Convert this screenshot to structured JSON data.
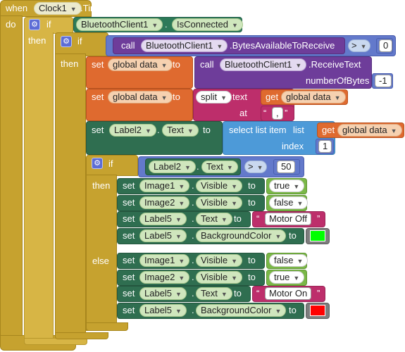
{
  "event": {
    "when": "when",
    "component": "Clock1",
    "event": ".Timer",
    "do": "do"
  },
  "outer_if": {
    "if": "if",
    "then": "then",
    "component": "BluetoothClient1",
    "property": "IsConnected"
  },
  "inner_if": {
    "if": "if",
    "then": "then",
    "call": "call",
    "component": "BluetoothClient1",
    "method": ".BytesAvailableToReceive",
    "op": ">",
    "value": "0"
  },
  "set_data_receive": {
    "set": "set",
    "var": "global data",
    "to": "to",
    "call": "call",
    "component": "BluetoothClient1",
    "method": ".ReceiveText",
    "param": "numberOfBytes",
    "param_value": "-1"
  },
  "set_data_split": {
    "set": "set",
    "var": "global data",
    "to": "to",
    "split": "split",
    "text_label": "text",
    "get": "get",
    "get_var": "global data",
    "at_label": "at",
    "at_value": ","
  },
  "set_label2": {
    "set": "set",
    "component": "Label2",
    "property": "Text",
    "to": "to",
    "select": "select list item",
    "list_label": "list",
    "get": "get",
    "get_var": "global data",
    "index_label": "index",
    "index_value": "1"
  },
  "if_label": {
    "if": "if",
    "then": "then",
    "else": "else",
    "component": "Label2",
    "property": "Text",
    "op": ">",
    "value": "50"
  },
  "then_rows": [
    {
      "set": "set",
      "component": "Image1",
      "property": "Visible",
      "to": "to",
      "value": "true",
      "kind": "bool"
    },
    {
      "set": "set",
      "component": "Image2",
      "property": "Visible",
      "to": "to",
      "value": "false",
      "kind": "bool"
    },
    {
      "set": "set",
      "component": "Label5",
      "property": "Text",
      "to": "to",
      "value": "Motor Off",
      "kind": "text"
    },
    {
      "set": "set",
      "component": "Label5",
      "property": "BackgroundColor",
      "to": "to",
      "value": "#00ff00",
      "kind": "color"
    }
  ],
  "else_rows": [
    {
      "set": "set",
      "component": "Image1",
      "property": "Visible",
      "to": "to",
      "value": "false",
      "kind": "bool"
    },
    {
      "set": "set",
      "component": "Image2",
      "property": "Visible",
      "to": "to",
      "value": "true",
      "kind": "bool"
    },
    {
      "set": "set",
      "component": "Label5",
      "property": "Text",
      "to": "to",
      "value": "Motor On",
      "kind": "text"
    },
    {
      "set": "set",
      "component": "Label5",
      "property": "BackgroundColor",
      "to": "to",
      "value": "#ff0000",
      "kind": "color"
    }
  ],
  "quote_open": "“",
  "quote_close": "”",
  "gear_icon": "gear-icon",
  "dropdown_icon": "chevron-down-icon"
}
